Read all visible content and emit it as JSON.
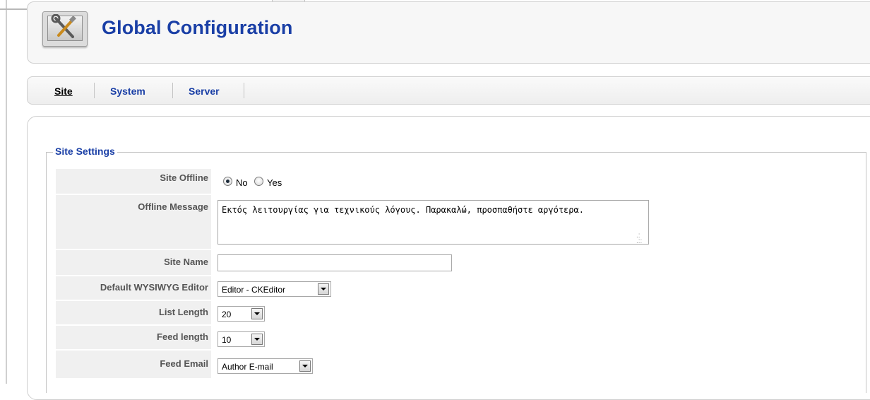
{
  "header": {
    "title": "Global Configuration",
    "icon": "tools-icon"
  },
  "tabs": [
    {
      "label": "Site",
      "active": true
    },
    {
      "label": "System",
      "active": false
    },
    {
      "label": "Server",
      "active": false
    }
  ],
  "site_settings": {
    "legend": "Site Settings",
    "site_offline": {
      "label": "Site Offline",
      "options": [
        "No",
        "Yes"
      ],
      "selected": "No"
    },
    "offline_message": {
      "label": "Offline Message",
      "value": "Εκτός λειτουργίας για τεχνικούς λόγους. Παρακαλώ, προσπαθήστε αργότερα."
    },
    "site_name": {
      "label": "Site Name",
      "value": ""
    },
    "default_editor": {
      "label": "Default WYSIWYG Editor",
      "value": "Editor - CKEditor"
    },
    "list_length": {
      "label": "List Length",
      "value": "20"
    },
    "feed_length": {
      "label": "Feed length",
      "value": "10"
    },
    "feed_email": {
      "label": "Feed Email",
      "value": "Author E-mail"
    }
  },
  "colors": {
    "title_blue": "#1a3fa6",
    "label_bg": "#f0f0f0"
  }
}
